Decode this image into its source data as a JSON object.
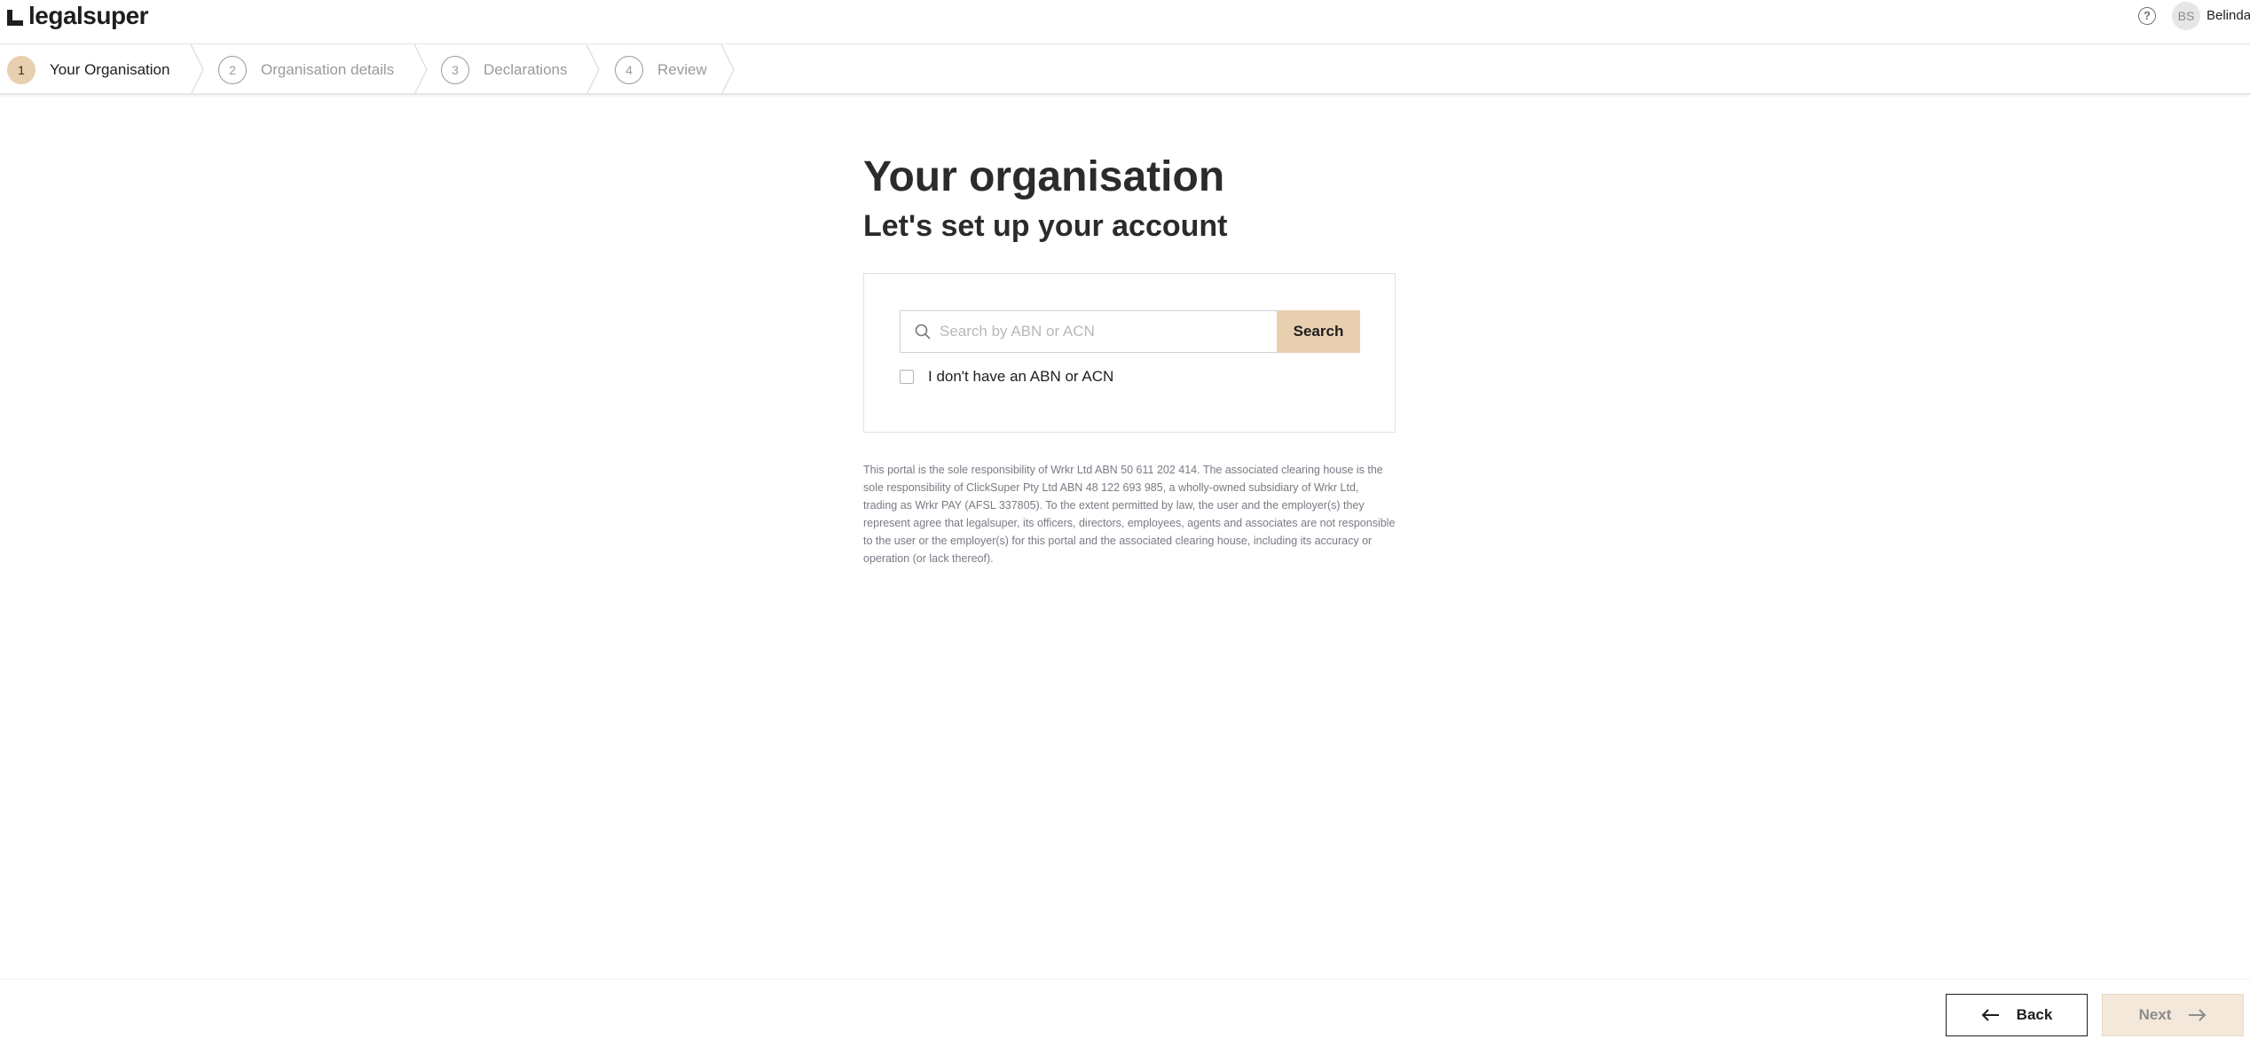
{
  "header": {
    "logo_text": "legalsuper",
    "help_icon": "question-circle-icon",
    "avatar_initials": "BS",
    "user_name": "Belinda"
  },
  "stepper": {
    "steps": [
      {
        "number": "1",
        "label": "Your Organisation",
        "state": "active"
      },
      {
        "number": "2",
        "label": "Organisation details",
        "state": "inactive"
      },
      {
        "number": "3",
        "label": "Declarations",
        "state": "inactive"
      },
      {
        "number": "4",
        "label": "Review",
        "state": "inactive"
      }
    ]
  },
  "main": {
    "title": "Your organisation",
    "subtitle": "Let's set up your account",
    "search": {
      "placeholder": "Search by ABN or ACN",
      "value": "",
      "button_label": "Search"
    },
    "no_abn_checkbox": {
      "label": "I don't have an ABN or ACN",
      "checked": false
    },
    "disclaimer": "This portal is the sole responsibility of Wrkr Ltd ABN 50 611 202 414. The associated clearing house is the sole responsibility of ClickSuper Pty Ltd ABN 48 122 693 985, a wholly-owned subsidiary of Wrkr Ltd, trading as Wrkr PAY (AFSL 337805). To the extent permitted by law, the user and the employer(s) they represent agree that legalsuper, its officers, directors, employees, agents and associates are not responsible to the user or the employer(s) for this portal and the associated clearing house, including its accuracy or operation (or lack thereof)."
  },
  "footer": {
    "back_label": "Back",
    "next_label": "Next",
    "next_enabled": false
  },
  "colors": {
    "accent": "#e8cfb0",
    "accent_disabled": "#f3e8da",
    "text": "#2b2b2b",
    "muted": "#9a9a9a"
  }
}
